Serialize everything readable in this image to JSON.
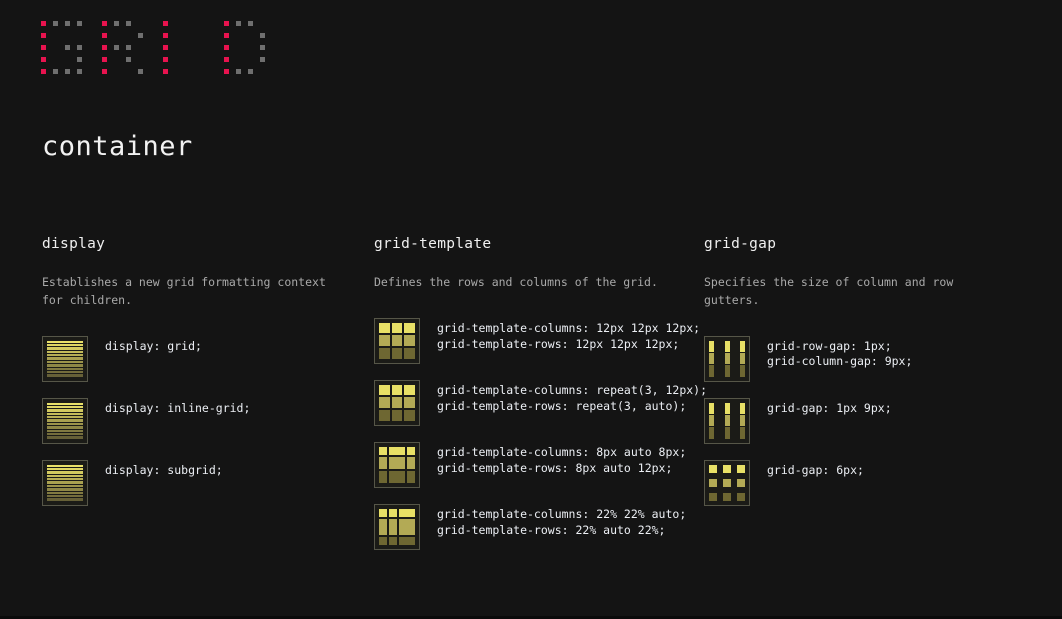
{
  "logo": {
    "name": "grid-logo",
    "text": "GRID",
    "dot_on_color": "#e8134f",
    "dot_off_color": "#6f6f6f",
    "glyphs": [
      {
        "letter": "G",
        "rows": [
          [
            1,
            2,
            2,
            2
          ],
          [
            1,
            0,
            0,
            0
          ],
          [
            1,
            0,
            2,
            2
          ],
          [
            1,
            0,
            0,
            2
          ],
          [
            1,
            2,
            2,
            2
          ]
        ]
      },
      {
        "letter": "R",
        "rows": [
          [
            1,
            2,
            2,
            0
          ],
          [
            1,
            0,
            0,
            2
          ],
          [
            1,
            2,
            2,
            0
          ],
          [
            1,
            0,
            2,
            0
          ],
          [
            1,
            0,
            0,
            2
          ]
        ]
      },
      {
        "letter": "I",
        "rows": [
          [
            1,
            0,
            0,
            0
          ],
          [
            1,
            0,
            0,
            0
          ],
          [
            1,
            0,
            0,
            0
          ],
          [
            1,
            0,
            0,
            0
          ],
          [
            1,
            0,
            0,
            0
          ]
        ]
      },
      {
        "letter": "D",
        "rows": [
          [
            1,
            2,
            2,
            0
          ],
          [
            1,
            0,
            0,
            2
          ],
          [
            1,
            0,
            0,
            2
          ],
          [
            1,
            0,
            0,
            2
          ],
          [
            1,
            2,
            2,
            0
          ]
        ]
      }
    ]
  },
  "page_title": "container",
  "columns": [
    {
      "id": "display",
      "title": "display",
      "description": "Establishes a new grid formatting context for children.",
      "examples": [
        {
          "thumb": "stripes",
          "lines": [
            "display: grid;"
          ]
        },
        {
          "thumb": "stripes",
          "lines": [
            "display: inline-grid;"
          ]
        },
        {
          "thumb": "stripes",
          "lines": [
            "display: subgrid;"
          ]
        }
      ]
    },
    {
      "id": "grid-template",
      "title": "grid-template",
      "description": "Defines the rows and columns of the grid.",
      "examples": [
        {
          "thumb": "grid-3x3",
          "lines": [
            "grid-template-columns: 12px 12px 12px;",
            "grid-template-rows: 12px 12px 12px;"
          ]
        },
        {
          "thumb": "grid-3x3",
          "lines": [
            "grid-template-columns: repeat(3, 12px);",
            "grid-template-rows: repeat(3, auto);"
          ]
        },
        {
          "thumb": "grid-auto",
          "lines": [
            "grid-template-columns: 8px auto 8px;",
            "grid-template-rows: 8px auto 12px;"
          ]
        },
        {
          "thumb": "grid-percent",
          "lines": [
            "grid-template-columns: 22% 22% auto;",
            "grid-template-rows: 22% auto 22%;"
          ]
        }
      ]
    },
    {
      "id": "grid-gap",
      "title": "grid-gap",
      "description": "Specifies the size of column and row gutters.",
      "examples": [
        {
          "thumb": "gap-row-col",
          "lines": [
            "grid-row-gap: 1px;",
            "grid-column-gap: 9px;"
          ]
        },
        {
          "thumb": "gap-row-col",
          "lines": [
            "grid-gap: 1px 9px;"
          ]
        },
        {
          "thumb": "gap-even",
          "lines": [
            "grid-gap: 6px;"
          ]
        }
      ]
    }
  ],
  "theme": {
    "background": "#141414",
    "accent": "#e8134f",
    "cell_bright": "#e8e066",
    "cell_dark": "#6e6732",
    "text": "#eceff4",
    "muted_text": "#a9a9a9"
  }
}
